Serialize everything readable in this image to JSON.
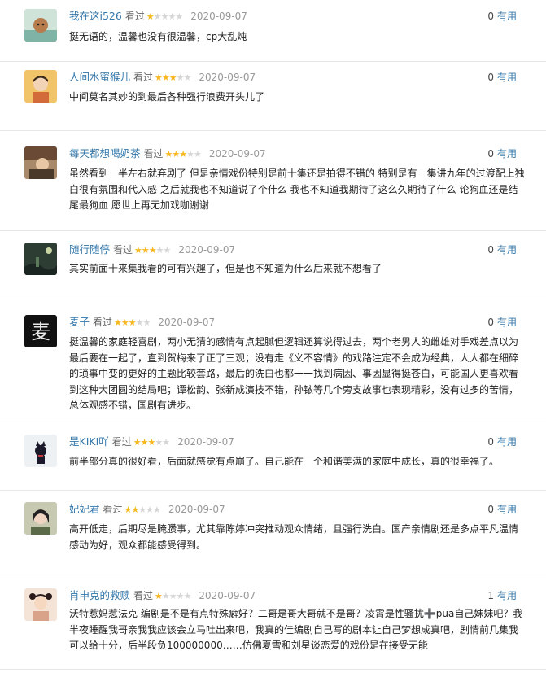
{
  "comments": [
    {
      "user": "我在这i526",
      "watched": "看过",
      "rating": 1,
      "date": "2020-09-07",
      "votes": "0",
      "useful": "有用",
      "text": "挺无语的，温馨也没有很温馨，cp大乱炖",
      "avatar_color": "#7fb3a6"
    },
    {
      "user": "人间水蜜猴儿",
      "watched": "看过",
      "rating": 3,
      "date": "2020-09-07",
      "votes": "0",
      "useful": "有用",
      "text": "中间莫名其妙的到最后各种强行浪费开头儿了",
      "avatar_color": "#e8a24a"
    },
    {
      "user": "每天都想喝奶茶",
      "watched": "看过",
      "rating": 3,
      "date": "2020-09-07",
      "votes": "0",
      "useful": "有用",
      "text": "虽然看到一半左右就弃剧了 但是亲情戏份特别是前十集还是拍得不错的 特别是有一集讲九年的过渡配上独白很有氛围和代入感 之后就我也不知道说了个什么 我也不知道我期待了这么久期待了什么 论狗血还是结尾最狗血 愿世上再无加戏咖谢谢",
      "avatar_color": "#8a6a4a"
    },
    {
      "user": "随行随停",
      "watched": "看过",
      "rating": 3,
      "date": "2020-09-07",
      "votes": "0",
      "useful": "有用",
      "text": "其实前面十来集我看的可有兴趣了，但是也不知道为什么后来就不想看了",
      "avatar_color": "#2e3d34"
    },
    {
      "user": "麦子",
      "watched": "看过",
      "rating": 3,
      "date": "2020-09-07",
      "votes": "0",
      "useful": "有用",
      "text": "挺温馨的家庭轻喜剧，两小无猜的感情有点起腻但逻辑还算说得过去，两个老男人的雌雄对手戏差点以为最后要在一起了，直到贺梅来了正了三观；没有走《义不容情》的戏路注定不会成为经典，人人都在细碎的琐事中变的更好的主题比较套路，最后的洗白也都一一找到病因、事因显得挺苍白，可能国人更喜欢看到这种大团圆的结局吧；谭松韵、张新成演技不错，孙铱等几个旁支故事也表现精彩，没有过多的苦情，总体观感不错，国剧有进步。",
      "avatar_color": "#111111"
    },
    {
      "user": "是KIKI吖",
      "watched": "看过",
      "rating": 3,
      "date": "2020-09-07",
      "votes": "0",
      "useful": "有用",
      "text": "前半部分真的很好看，后面就感觉有点崩了。自己能在一个和谐美满的家庭中成长，真的很幸福了。",
      "avatar_color": "#eef1f4"
    },
    {
      "user": "妃妃君",
      "watched": "看过",
      "rating": 2,
      "date": "2020-09-07",
      "votes": "0",
      "useful": "有用",
      "text": "高开低走，后期尽是腌臜事，尤其靠陈婷冲突推动观众情绪，且强行洗白。国产亲情剧还是多点平凡温情感动为好，观众都能感受得到。",
      "avatar_color": "#5b6b4a"
    },
    {
      "user": "肖申克的救赎",
      "watched": "看过",
      "rating": 1,
      "date": "2020-09-07",
      "votes": "1",
      "useful": "有用",
      "text": "沃特惹妈惹法克 编剧是不是有点特殊癖好？二哥是哥大哥就不是哥？凌霄是性骚扰➕pua自己妹妹吧？我半夜睡醒我哥亲我我应该会立马吐出来吧，我真的佳编剧自己写的剧本让自己梦想成真吧，剧情前几集我可以给十分，后半段负100000000……仿佛夏雪和刘星谈恋爱的戏份是在接受无能",
      "avatar_color": "#d9a38a"
    }
  ]
}
